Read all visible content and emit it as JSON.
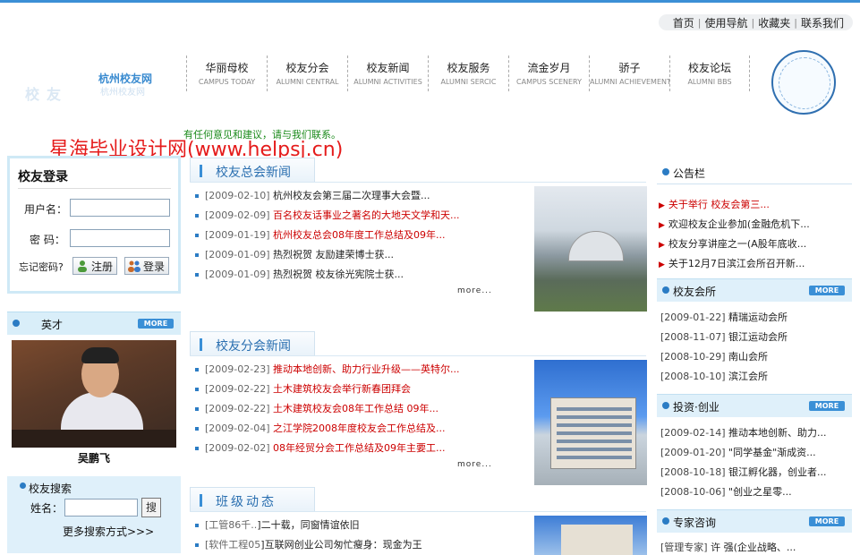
{
  "top_links": [
    "首页",
    "使用导航",
    "收藏夹",
    "联系我们"
  ],
  "logo": {
    "title": "杭州校友网",
    "subtitle": "杭州校友网"
  },
  "nav": [
    {
      "cn": "华丽母校",
      "en": "CAMPUS TODAY"
    },
    {
      "cn": "校友分会",
      "en": "ALUMNI CENTRAL"
    },
    {
      "cn": "校友新闻",
      "en": "ALUMNI ACTIVITIES"
    },
    {
      "cn": "校友服务",
      "en": "ALUMNI SERCIC"
    },
    {
      "cn": "流金岁月",
      "en": "CAMPUS SCENERY"
    },
    {
      "cn": "骄子",
      "en": "ALUMNI ACHIEVEMENT"
    },
    {
      "cn": "校友论坛",
      "en": "ALUMNI BBS"
    }
  ],
  "notice": "有任何意见和建议，请与我们联系。",
  "watermark": "星海毕业设计网(www.helpsj.cn)",
  "login": {
    "title": "校友登录",
    "username_label": "用户名：",
    "password_label": "密  码：",
    "forgot": "忘记密码?",
    "register": "注册",
    "login": "登录"
  },
  "talent": {
    "title": "英才",
    "more": "MORE",
    "caption": "吴鹏飞"
  },
  "search": {
    "title": "校友搜索",
    "name_label": "姓名：",
    "button": "搜",
    "advanced": "更多搜索方式>>>"
  },
  "news": {
    "title": "校友总会新闻",
    "more": "more...",
    "items": [
      {
        "date": "[2009-02-10]",
        "title": "杭州校友会第三届二次理事大会暨...",
        "red": false
      },
      {
        "date": "[2009-02-09]",
        "title": "百名校友话事业之著名的大地天文学和天...",
        "red": true
      },
      {
        "date": "[2009-01-19]",
        "title": "杭州校友总会08年度工作总结及09年...",
        "red": true
      },
      {
        "date": "[2009-01-09]",
        "title": "热烈祝贺    友励建荣博士获...",
        "red": false
      },
      {
        "date": "[2009-01-09]",
        "title": "热烈祝贺    校友徐光宪院士获...",
        "red": false
      }
    ]
  },
  "branch": {
    "title": "校友分会新闻",
    "more": "more...",
    "items": [
      {
        "date": "[2009-02-23]",
        "title": "推动本地创新、助力行业升级——英特尔...",
        "red": true
      },
      {
        "date": "[2009-02-22]",
        "title": "土木建筑校友会举行新春团拜会",
        "red": true
      },
      {
        "date": "[2009-02-22]",
        "title": "土木建筑校友会08年工作总结 09年...",
        "red": true
      },
      {
        "date": "[2009-02-04]",
        "title": "之江学院2008年度校友会工作总结及...",
        "red": true
      },
      {
        "date": "[2009-02-02]",
        "title": "08年经贸分会工作总结及09年主要工...",
        "red": true
      }
    ]
  },
  "class": {
    "title": "班级动态",
    "items": [
      {
        "date": "[工管86千..",
        "title": "]二十载，同窗情谊依旧"
      },
      {
        "date": "[软件工程05",
        "title": "]互联网创业公司匆忙瘦身：现金为王"
      }
    ]
  },
  "bulletin": {
    "title": "公告栏",
    "items": [
      {
        "title": "关于举行   校友会第三...",
        "red": true
      },
      {
        "title": "欢迎校友企业参加(金融危机下...",
        "red": false
      },
      {
        "title": "校友分享讲座之一(A股年底收...",
        "red": false
      },
      {
        "title": "关于12月7日滨江会所召开新...",
        "red": false
      }
    ]
  },
  "club": {
    "title": "校友会所",
    "more": "MORE",
    "items": [
      {
        "date": "[2009-01-22]",
        "title": "精瑞运动会所"
      },
      {
        "date": "[2008-11-07]",
        "title": "银江运动会所"
      },
      {
        "date": "[2008-10-29]",
        "title": "南山会所"
      },
      {
        "date": "[2008-10-10]",
        "title": "滨江会所"
      }
    ]
  },
  "invest": {
    "title": "投资·创业",
    "more": "MORE",
    "items": [
      {
        "date": "[2009-02-14]",
        "title": "推动本地创新、助力..."
      },
      {
        "date": "[2009-01-20]",
        "title": "\"同学基金\"渐成资..."
      },
      {
        "date": "[2008-10-18]",
        "title": "银江孵化器，创业者..."
      },
      {
        "date": "[2008-10-06]",
        "title": "   \"创业之星零..."
      }
    ]
  },
  "expert": {
    "title": "专家咨询",
    "more": "MORE",
    "items": [
      {
        "date": "[管理专家]",
        "title": "许 强(企业战略、..."
      }
    ]
  }
}
